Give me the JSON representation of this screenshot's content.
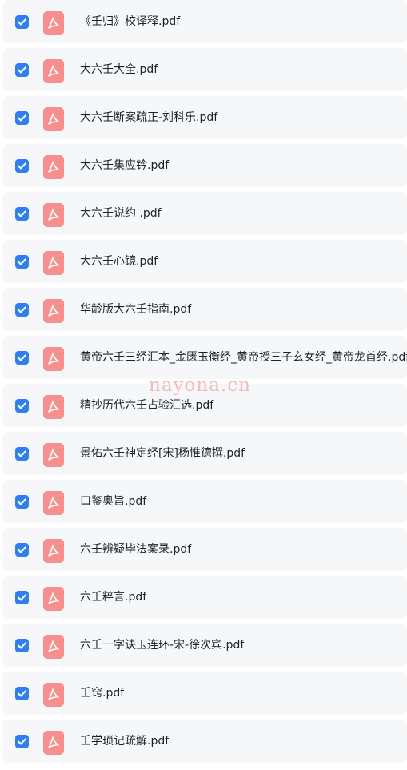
{
  "files": [
    {
      "name": "《壬归》校译释.pdf",
      "checked": true
    },
    {
      "name": "大六壬大全.pdf",
      "checked": true
    },
    {
      "name": "大六壬断案疏正-刘科乐.pdf",
      "checked": true
    },
    {
      "name": "大六壬集应钤.pdf",
      "checked": true
    },
    {
      "name": "大六壬说约 .pdf",
      "checked": true
    },
    {
      "name": "大六壬心镜.pdf",
      "checked": true
    },
    {
      "name": "华龄版大六壬指南.pdf",
      "checked": true
    },
    {
      "name": "黄帝六壬三经汇本_金匮玉衡经_黄帝授三子玄女经_黄帝龙首经.pdf",
      "checked": true
    },
    {
      "name": "精抄历代六壬占验汇选.pdf",
      "checked": true
    },
    {
      "name": "景佑六壬神定经[宋]杨惟德撰.pdf",
      "checked": true
    },
    {
      "name": "口鉴奥旨.pdf",
      "checked": true
    },
    {
      "name": "六壬辨疑毕法案录.pdf",
      "checked": true
    },
    {
      "name": "六壬粹言.pdf",
      "checked": true
    },
    {
      "name": "六壬一字诀玉连环-宋-徐次宾.pdf",
      "checked": true
    },
    {
      "name": "壬窍.pdf",
      "checked": true
    },
    {
      "name": "壬学琐记疏解.pdf",
      "checked": true
    }
  ],
  "icons": {
    "checkbox": "checkbox-checked-icon",
    "file": "pdf-file-icon"
  },
  "colors": {
    "checkbox": "#2f80ed",
    "pdf_icon": "#f78f8f",
    "row_background": "#f6f7f9",
    "text": "#1f2329"
  },
  "watermark": "nayona.cn"
}
